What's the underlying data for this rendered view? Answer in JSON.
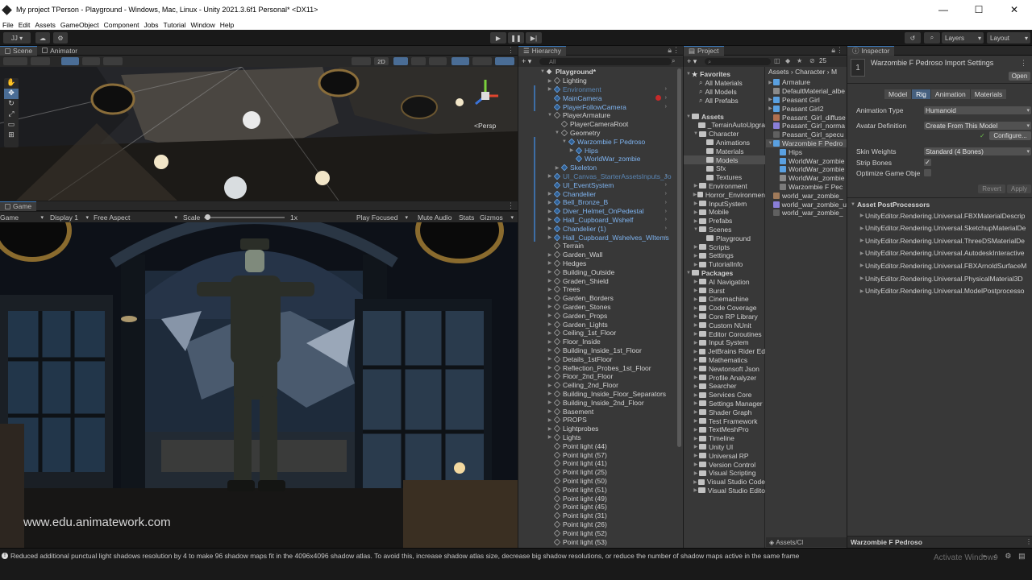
{
  "window": {
    "title": "My project TPerson - Playground - Windows, Mac, Linux - Unity 2021.3.6f1 Personal* <DX11>",
    "controls": [
      "—",
      "☐",
      "✕"
    ]
  },
  "menu": [
    "File",
    "Edit",
    "Assets",
    "GameObject",
    "Component",
    "Jobs",
    "Tutorial",
    "Window",
    "Help"
  ],
  "toolbar": {
    "account": "JJ",
    "play": "▶",
    "pause": "❚❚",
    "step": "▶|",
    "layers": "Layers",
    "layout": "Layout"
  },
  "scene": {
    "tabs": [
      "Scene",
      "Animator"
    ],
    "mode_2d": "2D",
    "persp": "<Persp"
  },
  "game": {
    "tab": "Game",
    "display_type": "Game",
    "display": "Display 1",
    "aspect": "Free Aspect",
    "scale_label": "Scale",
    "scale_value": "1x",
    "scale_fraction": 0.02,
    "play_focused": "Play Focused",
    "mute": "Mute Audio",
    "stats": "Stats",
    "gizmos": "Gizmos",
    "watermark": "www.edu.animatework.com"
  },
  "hierarchy": {
    "tab": "Hierarchy",
    "search_placeholder": "All",
    "rows": [
      {
        "label": "Playground*",
        "depth": 0,
        "tri": "▼",
        "style": "bold",
        "icon": "scene"
      },
      {
        "label": "Lighting",
        "depth": 1,
        "tri": "▶",
        "style": "",
        "icon": "cube"
      },
      {
        "label": "Environment",
        "depth": 1,
        "tri": "▶",
        "style": "faded",
        "icon": "cube-blue",
        "arrow": true
      },
      {
        "label": "MainCamera",
        "depth": 1,
        "tri": "",
        "style": "blue",
        "icon": "cube-blue",
        "arrow": true,
        "marker": true
      },
      {
        "label": "PlayerFollowCamera",
        "depth": 1,
        "tri": "",
        "style": "blue",
        "icon": "cube-blue",
        "arrow": true
      },
      {
        "label": "PlayerArmature",
        "depth": 1,
        "tri": "▼",
        "style": "",
        "icon": "cube"
      },
      {
        "label": "PlayerCameraRoot",
        "depth": 2,
        "tri": "",
        "style": "",
        "icon": "cube"
      },
      {
        "label": "Geometry",
        "depth": 2,
        "tri": "▼",
        "style": "",
        "icon": "cube"
      },
      {
        "label": "Warzombie F Pedroso",
        "depth": 3,
        "tri": "▼",
        "style": "blue",
        "icon": "cube-blue"
      },
      {
        "label": "Hips",
        "depth": 4,
        "tri": "▶",
        "style": "blue",
        "icon": "cube-blue"
      },
      {
        "label": "WorldWar_zombie",
        "depth": 4,
        "tri": "",
        "style": "blue",
        "icon": "cube-blue"
      },
      {
        "label": "Skeleton",
        "depth": 2,
        "tri": "▶",
        "style": "blue",
        "icon": "cube-blue"
      },
      {
        "label": "UI_Canvas_StarterAssetsInputs_Jo",
        "depth": 1,
        "tri": "▶",
        "style": "faded",
        "icon": "cube-blue",
        "arrow": true
      },
      {
        "label": "UI_EventSystem",
        "depth": 1,
        "tri": "",
        "style": "blue",
        "icon": "cube-blue",
        "arrow": true
      },
      {
        "label": "Chandelier",
        "depth": 1,
        "tri": "▶",
        "style": "blue",
        "icon": "cube-blue",
        "arrow": true
      },
      {
        "label": "Bell_Bronze_B",
        "depth": 1,
        "tri": "▶",
        "style": "blue",
        "icon": "cube-blue",
        "arrow": true
      },
      {
        "label": "Diver_Helmet_OnPedestal",
        "depth": 1,
        "tri": "▶",
        "style": "blue",
        "icon": "cube-blue",
        "arrow": true
      },
      {
        "label": "Hall_Cupboard_Wshelf",
        "depth": 1,
        "tri": "▶",
        "style": "blue",
        "icon": "cube-blue",
        "arrow": true
      },
      {
        "label": "Chandelier (1)",
        "depth": 1,
        "tri": "▶",
        "style": "blue",
        "icon": "cube-blue",
        "arrow": true
      },
      {
        "label": "Hall_Cupboard_Wshelves_WItems",
        "depth": 1,
        "tri": "▶",
        "style": "blue",
        "icon": "cube-blue",
        "arrow": true
      },
      {
        "label": "Terrain",
        "depth": 1,
        "tri": "",
        "style": "",
        "icon": "cube"
      },
      {
        "label": "Garden_Wall",
        "depth": 1,
        "tri": "▶",
        "style": "",
        "icon": "cube"
      },
      {
        "label": "Hedges",
        "depth": 1,
        "tri": "▶",
        "style": "",
        "icon": "cube"
      },
      {
        "label": "Building_Outside",
        "depth": 1,
        "tri": "▶",
        "style": "",
        "icon": "cube"
      },
      {
        "label": "Graden_Shield",
        "depth": 1,
        "tri": "▶",
        "style": "",
        "icon": "cube"
      },
      {
        "label": "Trees",
        "depth": 1,
        "tri": "▶",
        "style": "",
        "icon": "cube"
      },
      {
        "label": "Garden_Borders",
        "depth": 1,
        "tri": "▶",
        "style": "",
        "icon": "cube"
      },
      {
        "label": "Garden_Stones",
        "depth": 1,
        "tri": "▶",
        "style": "",
        "icon": "cube"
      },
      {
        "label": "Garden_Props",
        "depth": 1,
        "tri": "▶",
        "style": "",
        "icon": "cube"
      },
      {
        "label": "Garden_Lights",
        "depth": 1,
        "tri": "▶",
        "style": "",
        "icon": "cube"
      },
      {
        "label": "Ceiling_1st_Floor",
        "depth": 1,
        "tri": "▶",
        "style": "",
        "icon": "cube"
      },
      {
        "label": "Floor_Inside",
        "depth": 1,
        "tri": "▶",
        "style": "",
        "icon": "cube"
      },
      {
        "label": "Building_Inside_1st_Floor",
        "depth": 1,
        "tri": "▶",
        "style": "",
        "icon": "cube"
      },
      {
        "label": "Details_1stFloor",
        "depth": 1,
        "tri": "▶",
        "style": "",
        "icon": "cube"
      },
      {
        "label": "Reflection_Probes_1st_Floor",
        "depth": 1,
        "tri": "▶",
        "style": "",
        "icon": "cube"
      },
      {
        "label": "Floor_2nd_Floor",
        "depth": 1,
        "tri": "▶",
        "style": "",
        "icon": "cube"
      },
      {
        "label": "Ceiling_2nd_Floor",
        "depth": 1,
        "tri": "▶",
        "style": "",
        "icon": "cube"
      },
      {
        "label": "Building_Inside_Floor_Separators",
        "depth": 1,
        "tri": "▶",
        "style": "",
        "icon": "cube"
      },
      {
        "label": "Building_Inside_2nd_Floor",
        "depth": 1,
        "tri": "▶",
        "style": "",
        "icon": "cube"
      },
      {
        "label": "Basement",
        "depth": 1,
        "tri": "▶",
        "style": "",
        "icon": "cube"
      },
      {
        "label": "PROPS",
        "depth": 1,
        "tri": "▶",
        "style": "",
        "icon": "cube"
      },
      {
        "label": "Lightprobes",
        "depth": 1,
        "tri": "▶",
        "style": "",
        "icon": "cube"
      },
      {
        "label": "Lights",
        "depth": 1,
        "tri": "▶",
        "style": "",
        "icon": "cube"
      },
      {
        "label": "Point light (44)",
        "depth": 1,
        "tri": "",
        "style": "",
        "icon": "cube"
      },
      {
        "label": "Point light (57)",
        "depth": 1,
        "tri": "",
        "style": "",
        "icon": "cube"
      },
      {
        "label": "Point light (41)",
        "depth": 1,
        "tri": "",
        "style": "",
        "icon": "cube"
      },
      {
        "label": "Point light (25)",
        "depth": 1,
        "tri": "",
        "style": "",
        "icon": "cube"
      },
      {
        "label": "Point light (50)",
        "depth": 1,
        "tri": "",
        "style": "",
        "icon": "cube"
      },
      {
        "label": "Point light (51)",
        "depth": 1,
        "tri": "",
        "style": "",
        "icon": "cube"
      },
      {
        "label": "Point light (49)",
        "depth": 1,
        "tri": "",
        "style": "",
        "icon": "cube"
      },
      {
        "label": "Point light (45)",
        "depth": 1,
        "tri": "",
        "style": "",
        "icon": "cube"
      },
      {
        "label": "Point light (31)",
        "depth": 1,
        "tri": "",
        "style": "",
        "icon": "cube"
      },
      {
        "label": "Point light (26)",
        "depth": 1,
        "tri": "",
        "style": "",
        "icon": "cube"
      },
      {
        "label": "Point light (52)",
        "depth": 1,
        "tri": "",
        "style": "",
        "icon": "cube"
      },
      {
        "label": "Point light (53)",
        "depth": 1,
        "tri": "",
        "style": "",
        "icon": "cube"
      }
    ]
  },
  "project": {
    "tab": "Project",
    "count": "25",
    "breadcrumb": [
      "Assets",
      "Character",
      "M"
    ],
    "tree": [
      {
        "label": "Favorites",
        "depth": 0,
        "tri": "▼",
        "header": true,
        "icon": "star"
      },
      {
        "label": "All Materials",
        "depth": 1,
        "icon": "search"
      },
      {
        "label": "All Models",
        "depth": 1,
        "icon": "search"
      },
      {
        "label": "All Prefabs",
        "depth": 1,
        "icon": "search"
      },
      {
        "label": "",
        "depth": 0,
        "spacer": true
      },
      {
        "label": "Assets",
        "depth": 0,
        "tri": "▼",
        "header": true,
        "icon": "folder"
      },
      {
        "label": "_TerrainAutoUpgra",
        "depth": 1,
        "icon": "folder"
      },
      {
        "label": "Character",
        "depth": 1,
        "tri": "▼",
        "icon": "folder"
      },
      {
        "label": "Animations",
        "depth": 2,
        "icon": "folder"
      },
      {
        "label": "Materials",
        "depth": 2,
        "icon": "folder"
      },
      {
        "label": "Models",
        "depth": 2,
        "icon": "folder",
        "selected": true
      },
      {
        "label": "Sfx",
        "depth": 2,
        "icon": "folder"
      },
      {
        "label": "Textures",
        "depth": 2,
        "icon": "folder"
      },
      {
        "label": "Environment",
        "depth": 1,
        "tri": "▶",
        "icon": "folder"
      },
      {
        "label": "Horror_Environmen",
        "depth": 1,
        "tri": "▶",
        "icon": "folder"
      },
      {
        "label": "InputSystem",
        "depth": 1,
        "tri": "▶",
        "icon": "folder"
      },
      {
        "label": "Mobile",
        "depth": 1,
        "tri": "▶",
        "icon": "folder"
      },
      {
        "label": "Prefabs",
        "depth": 1,
        "tri": "▶",
        "icon": "folder"
      },
      {
        "label": "Scenes",
        "depth": 1,
        "tri": "▼",
        "icon": "folder"
      },
      {
        "label": "Playground",
        "depth": 2,
        "icon": "folder"
      },
      {
        "label": "Scripts",
        "depth": 1,
        "tri": "▶",
        "icon": "folder"
      },
      {
        "label": "Settings",
        "depth": 1,
        "tri": "▶",
        "icon": "folder"
      },
      {
        "label": "TutorialInfo",
        "depth": 1,
        "tri": "▶",
        "icon": "folder"
      },
      {
        "label": "Packages",
        "depth": 0,
        "tri": "▼",
        "header": true,
        "icon": "folder"
      },
      {
        "label": "AI Navigation",
        "depth": 1,
        "tri": "▶",
        "icon": "folder"
      },
      {
        "label": "Burst",
        "depth": 1,
        "tri": "▶",
        "icon": "folder"
      },
      {
        "label": "Cinemachine",
        "depth": 1,
        "tri": "▶",
        "icon": "folder"
      },
      {
        "label": "Code Coverage",
        "depth": 1,
        "tri": "▶",
        "icon": "folder"
      },
      {
        "label": "Core RP Library",
        "depth": 1,
        "tri": "▶",
        "icon": "folder"
      },
      {
        "label": "Custom NUnit",
        "depth": 1,
        "tri": "▶",
        "icon": "folder"
      },
      {
        "label": "Editor Coroutines",
        "depth": 1,
        "tri": "▶",
        "icon": "folder"
      },
      {
        "label": "Input System",
        "depth": 1,
        "tri": "▶",
        "icon": "folder"
      },
      {
        "label": "JetBrains Rider Ed",
        "depth": 1,
        "tri": "▶",
        "icon": "folder"
      },
      {
        "label": "Mathematics",
        "depth": 1,
        "tri": "▶",
        "icon": "folder"
      },
      {
        "label": "Newtonsoft Json",
        "depth": 1,
        "tri": "▶",
        "icon": "folder"
      },
      {
        "label": "Profile Analyzer",
        "depth": 1,
        "tri": "▶",
        "icon": "folder"
      },
      {
        "label": "Searcher",
        "depth": 1,
        "tri": "▶",
        "icon": "folder"
      },
      {
        "label": "Services Core",
        "depth": 1,
        "tri": "▶",
        "icon": "folder"
      },
      {
        "label": "Settings Manager",
        "depth": 1,
        "tri": "▶",
        "icon": "folder"
      },
      {
        "label": "Shader Graph",
        "depth": 1,
        "tri": "▶",
        "icon": "folder"
      },
      {
        "label": "Test Framework",
        "depth": 1,
        "tri": "▶",
        "icon": "folder"
      },
      {
        "label": "TextMeshPro",
        "depth": 1,
        "tri": "▶",
        "icon": "folder"
      },
      {
        "label": "Timeline",
        "depth": 1,
        "tri": "▶",
        "icon": "folder"
      },
      {
        "label": "Unity UI",
        "depth": 1,
        "tri": "▶",
        "icon": "folder"
      },
      {
        "label": "Universal RP",
        "depth": 1,
        "tri": "▶",
        "icon": "folder"
      },
      {
        "label": "Version Control",
        "depth": 1,
        "tri": "▶",
        "icon": "folder"
      },
      {
        "label": "Visual Scripting",
        "depth": 1,
        "tri": "▶",
        "icon": "folder"
      },
      {
        "label": "Visual Studio Code",
        "depth": 1,
        "tri": "▶",
        "icon": "folder"
      },
      {
        "label": "Visual Studio Edito",
        "depth": 1,
        "tri": "▶",
        "icon": "folder"
      }
    ],
    "files": [
      {
        "label": "Armature",
        "color": "#5aa0e0",
        "tri": "▶"
      },
      {
        "label": "DefaultMaterial_albe",
        "color": "#8a8a8a"
      },
      {
        "label": "Peasant Girl",
        "color": "#5aa0e0",
        "tri": "▶"
      },
      {
        "label": "Peasant Girl2",
        "color": "#5aa0e0",
        "tri": "▶"
      },
      {
        "label": "Peasant_Girl_diffuse",
        "color": "#b07050"
      },
      {
        "label": "Peasant_Girl_norma",
        "color": "#8a7fd8"
      },
      {
        "label": "Peasant_Girl_specu",
        "color": "#606060"
      },
      {
        "label": "Warzombie F Pedro",
        "color": "#5aa0e0",
        "tri": "▼",
        "selected": true
      },
      {
        "label": "Hips",
        "color": "#5aa0e0",
        "indent": true
      },
      {
        "label": "WorldWar_zombie",
        "color": "#5aa0e0",
        "indent": true
      },
      {
        "label": "WorldWar_zombie",
        "color": "#5aa0e0",
        "indent": true
      },
      {
        "label": "WorldWar_zombie",
        "color": "#8a8a8a",
        "indent": true
      },
      {
        "label": "Warzombie F Pec",
        "color": "#7a7a7a",
        "indent": true
      },
      {
        "label": "world_war_zombie_",
        "color": "#a07a5a"
      },
      {
        "label": "world_war_zombie_u",
        "color": "#8a7fd8"
      },
      {
        "label": "world_war_zombie_",
        "color": "#606060"
      }
    ],
    "footer": "Assets/Cl"
  },
  "inspector": {
    "tab": "Inspector",
    "title": "Warzombie F Pedroso Import Settings",
    "open": "Open",
    "tabs": [
      "Model",
      "Rig",
      "Animation",
      "Materials"
    ],
    "active_tab": "Rig",
    "fields": [
      {
        "label": "Animation Type",
        "value": "Humanoid",
        "kind": "dropdown"
      },
      {
        "label": "Avatar Definition",
        "value": "Create From This Model",
        "kind": "dropdown"
      },
      {
        "label": "",
        "value": "Configure...",
        "kind": "button"
      },
      {
        "label": "Skin Weights",
        "value": "Standard (4 Bones)",
        "kind": "dropdown"
      },
      {
        "label": "Strip Bones",
        "value": "✓",
        "kind": "check"
      },
      {
        "label": "Optimize Game Obje",
        "value": "",
        "kind": "check"
      }
    ],
    "revert": "Revert",
    "apply": "Apply",
    "postprocessors_header": "Asset PostProcessors",
    "postprocessors": [
      "UnityEditor.Rendering.Universal.FBXMaterialDescrip",
      "UnityEditor.Rendering.Universal.SketchupMaterialDe",
      "UnityEditor.Rendering.Universal.ThreeDSMaterialDe",
      "UnityEditor.Rendering.Universal.AutodeskInteractive",
      "UnityEditor.Rendering.Universal.FBXArnoldSurfaceM",
      "UnityEditor.Rendering.Universal.PhysicalMaterial3D",
      "UnityEditor.Rendering.Universal.ModelPostprocesso"
    ],
    "footer": "Warzombie F Pedroso"
  },
  "status": {
    "message": "Reduced additional punctual light shadows resolution by 4 to make 96 shadow maps fit in the 4096x4096 shadow atlas. To avoid this, increase shadow atlas size, decrease big shadow resolutions, or reduce the number of shadow maps active in the same frame",
    "activate": "Activate Windows"
  }
}
